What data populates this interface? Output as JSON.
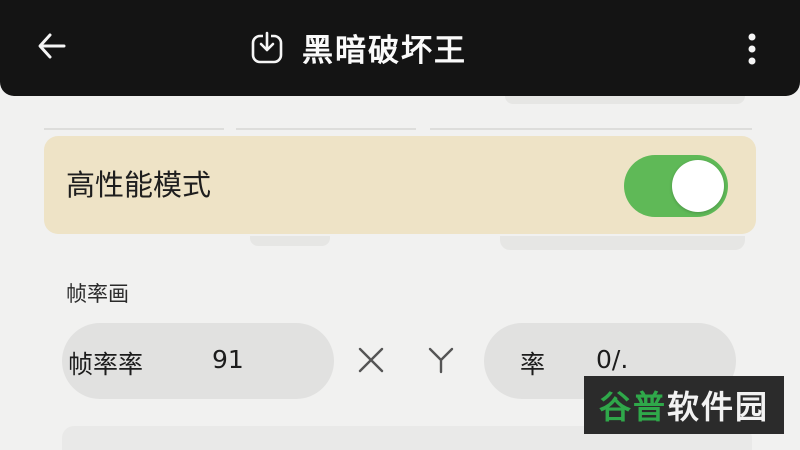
{
  "header": {
    "title": "黑暗破坏王",
    "back_icon": "arrow-left-icon",
    "title_icon": "download-icon",
    "more_icon": "more-vertical-icon"
  },
  "settings": {
    "performance_mode_label": "高性能模式",
    "performance_mode_on": true,
    "frame_section_label": "帧率画",
    "frame_rate_label": "帧率率",
    "frame_rate_value": "91",
    "x_symbol": "X",
    "y_symbol": "Y",
    "rate_label": "率",
    "rate_value": "0/."
  },
  "watermark": {
    "part1": "谷普",
    "part2": "软件园"
  },
  "colors": {
    "toggle_on": "#5fb957",
    "card_bg": "#eee3c6",
    "topbar_bg": "#141414",
    "watermark_green": "#2fa84a"
  }
}
